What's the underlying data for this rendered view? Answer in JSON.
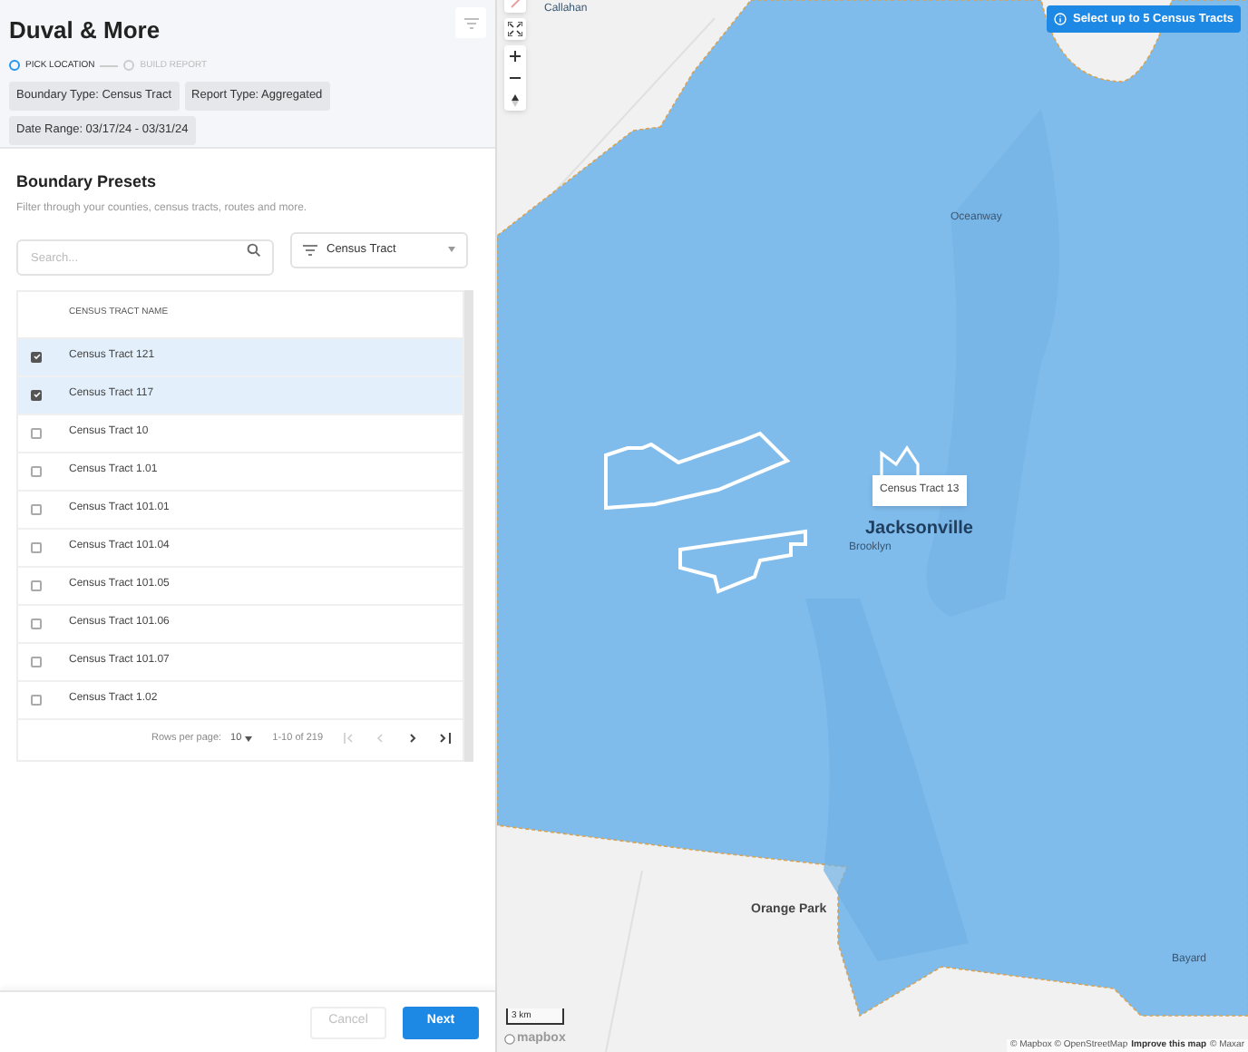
{
  "header": {
    "title": "Duval & More",
    "steps": [
      {
        "label": "PICK LOCATION",
        "selected": true
      },
      {
        "label": "BUILD REPORT",
        "selected": false
      }
    ],
    "chips": [
      "Boundary Type: Census Tract",
      "Report Type: Aggregated",
      "Date Range: 03/17/24 - 03/31/24"
    ]
  },
  "presets": {
    "title": "Boundary Presets",
    "subtitle": "Filter through your counties, census tracts, routes and more.",
    "search": {
      "placeholder": "Search..."
    },
    "filter": "Census Tract"
  },
  "table": {
    "column": "CENSUS TRACT NAME",
    "rows": [
      {
        "name": "Census Tract 121",
        "checked": true
      },
      {
        "name": "Census Tract 117",
        "checked": true
      },
      {
        "name": "Census Tract 10",
        "checked": false
      },
      {
        "name": "Census Tract 1.01",
        "checked": false
      },
      {
        "name": "Census Tract 101.01",
        "checked": false
      },
      {
        "name": "Census Tract 101.04",
        "checked": false
      },
      {
        "name": "Census Tract 101.05",
        "checked": false
      },
      {
        "name": "Census Tract 101.06",
        "checked": false
      },
      {
        "name": "Census Tract 101.07",
        "checked": false
      },
      {
        "name": "Census Tract 1.02",
        "checked": false
      }
    ],
    "pagination": {
      "rows_label": "Rows per page:",
      "rows_per_page": "10",
      "range": "1-10 of 219"
    }
  },
  "footer": {
    "buttons": [
      {
        "label": "Cancel",
        "kind": "secondary",
        "disabled": true
      },
      {
        "label": "Next",
        "kind": "primary",
        "disabled": false
      }
    ]
  },
  "map": {
    "banner": "Select up to 5 Census Tracts",
    "labels": [
      {
        "text": "Callahan",
        "kind": "town"
      },
      {
        "text": "Oceanway",
        "kind": "town"
      },
      {
        "text": "Jacksonville",
        "kind": "city"
      },
      {
        "text": "Brooklyn",
        "kind": "town"
      },
      {
        "text": "Orange Park",
        "kind": "city_small"
      },
      {
        "text": "Bayard",
        "kind": "town"
      }
    ],
    "tooltip": "Census Tract 13",
    "scale": "3 km",
    "logo": "mapbox",
    "attribution": "© Mapbox © OpenStreetMap",
    "improve_link": "Improve this map",
    "attribution_tail": "© Maxar"
  }
}
